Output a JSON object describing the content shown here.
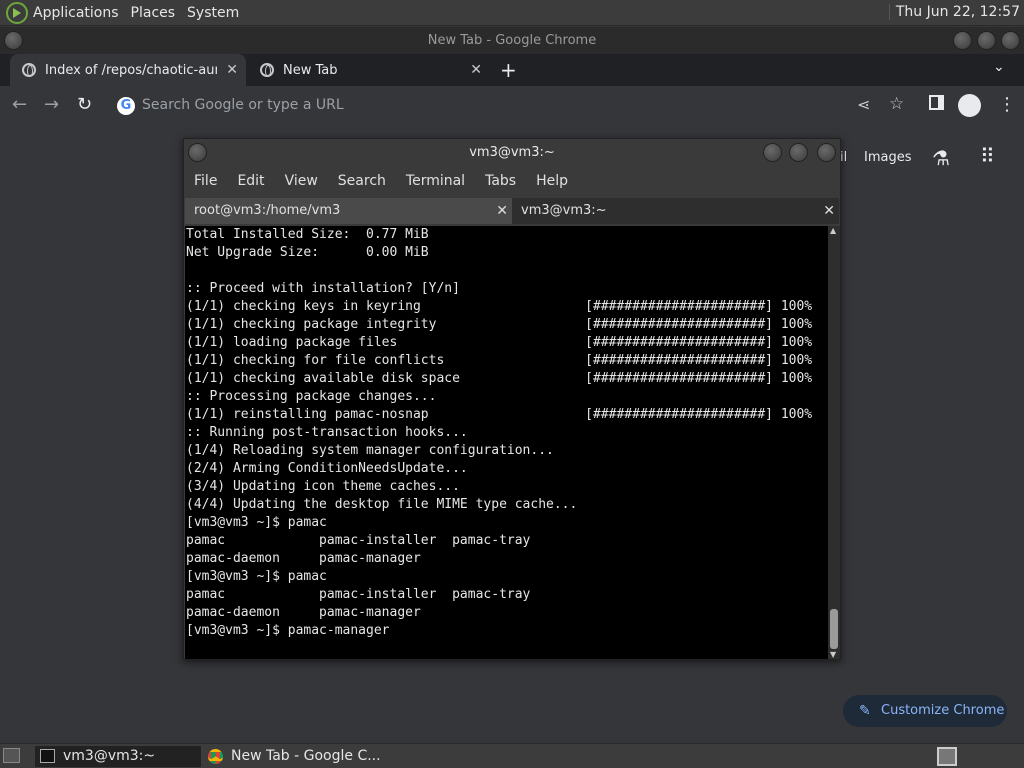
{
  "top_panel": {
    "menus": [
      "Applications",
      "Places",
      "System"
    ],
    "clock": "Thu Jun 22, 12:57"
  },
  "chrome": {
    "window_title": "New Tab - Google Chrome",
    "tabs": [
      {
        "label": "Index of /repos/chaotic-aur/x8"
      },
      {
        "label": "New Tab"
      }
    ],
    "omnibox_placeholder": "Search Google or type a URL",
    "ntp": {
      "gmail_partial": "il",
      "images": "Images",
      "customize": "Customize Chrome"
    }
  },
  "terminal": {
    "title": "vm3@vm3:~",
    "menu": [
      "File",
      "Edit",
      "View",
      "Search",
      "Terminal",
      "Tabs",
      "Help"
    ],
    "tabs": [
      {
        "label": "root@vm3:/home/vm3"
      },
      {
        "label": "vm3@vm3:~"
      }
    ],
    "lines": [
      "Total Installed Size:  0.77 MiB",
      "Net Upgrade Size:      0.00 MiB",
      "",
      ":: Proceed with installation? [Y/n]",
      "(1/1) checking keys in keyring                     [######################] 100%",
      "(1/1) checking package integrity                   [######################] 100%",
      "(1/1) loading package files                        [######################] 100%",
      "(1/1) checking for file conflicts                  [######################] 100%",
      "(1/1) checking available disk space                [######################] 100%",
      ":: Processing package changes...",
      "(1/1) reinstalling pamac-nosnap                    [######################] 100%",
      ":: Running post-transaction hooks...",
      "(1/4) Reloading system manager configuration...",
      "(2/4) Arming ConditionNeedsUpdate...",
      "(3/4) Updating icon theme caches...",
      "(4/4) Updating the desktop file MIME type cache...",
      "[vm3@vm3 ~]$ pamac",
      "pamac            pamac-installer  pamac-tray",
      "pamac-daemon     pamac-manager",
      "[vm3@vm3 ~]$ pamac",
      "pamac            pamac-installer  pamac-tray",
      "pamac-daemon     pamac-manager",
      "[vm3@vm3 ~]$ pamac-manager"
    ]
  },
  "taskbar": {
    "items": [
      {
        "label": "vm3@vm3:~"
      },
      {
        "label": "New Tab - Google C..."
      }
    ]
  }
}
